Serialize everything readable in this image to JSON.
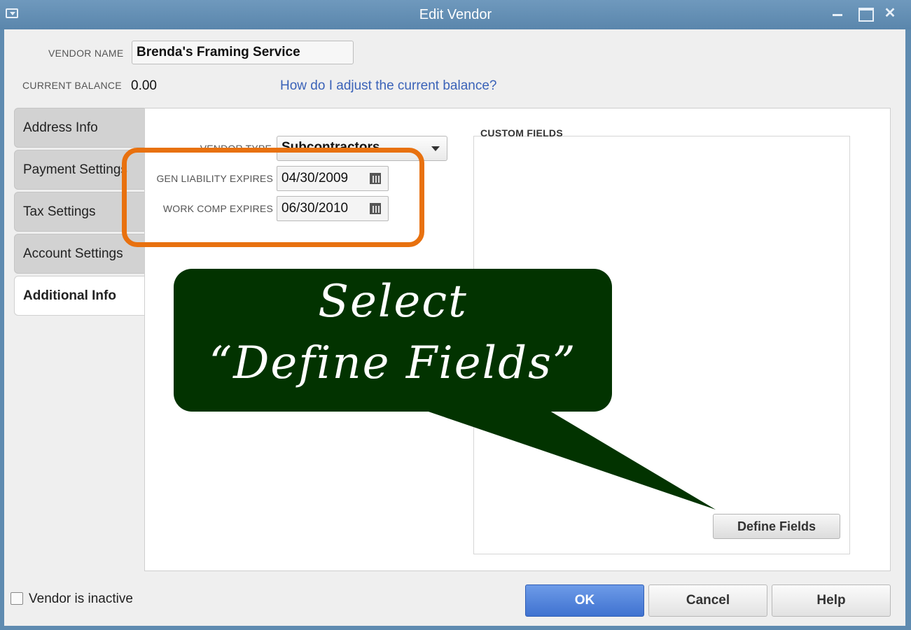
{
  "window": {
    "title": "Edit Vendor",
    "close_glyph": "✕"
  },
  "header": {
    "vendor_name_label": "VENDOR NAME",
    "vendor_name_value": "Brenda's Framing Service",
    "current_balance_label": "CURRENT BALANCE",
    "current_balance_value": "0.00",
    "help_link": "How do I adjust the current balance?"
  },
  "tabs": [
    {
      "label": "Address Info",
      "active": false
    },
    {
      "label": "Payment Settings",
      "active": false
    },
    {
      "label": "Tax Settings",
      "active": false
    },
    {
      "label": "Account Settings",
      "active": false
    },
    {
      "label": "Additional Info",
      "active": true
    }
  ],
  "additional_info": {
    "vendor_type_label": "VENDOR TYPE",
    "vendor_type_value": "Subcontractors",
    "gen_liability_label": "GEN LIABILITY EXPIRES",
    "gen_liability_value": "04/30/2009",
    "work_comp_label": "WORK COMP EXPIRES",
    "work_comp_value": "06/30/2010"
  },
  "custom_fields": {
    "title": "CUSTOM FIELDS",
    "define_button": "Define Fields"
  },
  "footer": {
    "inactive_label": "Vendor is inactive",
    "inactive_checked": false,
    "ok": "OK",
    "cancel": "Cancel",
    "help": "Help"
  },
  "callout": {
    "line1": "Select",
    "line2": "“Define Fields”",
    "highlight_color": "#e8710f",
    "bubble_color": "#023300"
  }
}
